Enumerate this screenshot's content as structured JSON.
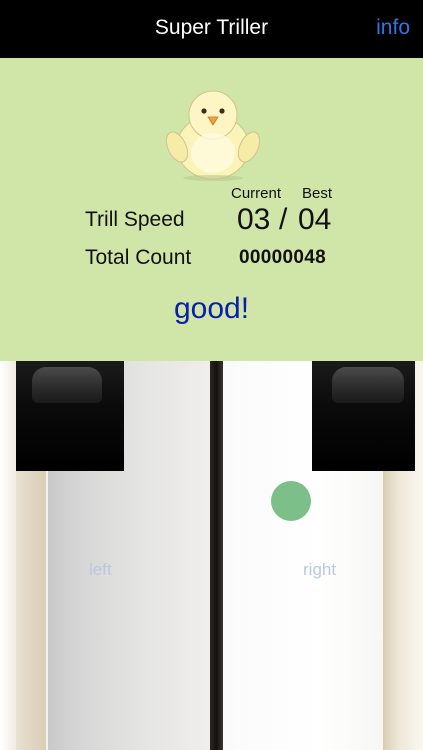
{
  "navbar": {
    "title": "Super Triller",
    "info_label": "info"
  },
  "score": {
    "header_current": "Current",
    "header_best": "Best",
    "trill_speed_label": "Trill Speed",
    "trill_speed_current": "03",
    "trill_speed_separator": "/",
    "trill_speed_best": "04",
    "total_count_label": "Total Count",
    "total_count_value": "00000048",
    "feedback": "good!"
  },
  "piano": {
    "left_label": "left",
    "right_label": "right"
  },
  "colors": {
    "panel_background": "#d0e6a8",
    "info_link": "#2a78e4",
    "feedback_text": "#0a1ea8",
    "touch_indicator": "#7dbf89"
  },
  "icons": {
    "mascot": "chick-mascot-icon"
  }
}
